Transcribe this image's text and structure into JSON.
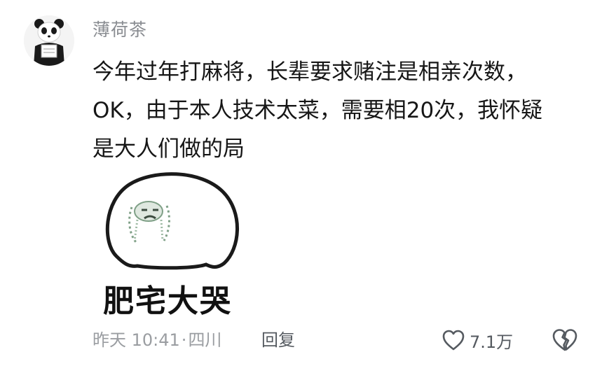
{
  "comment": {
    "username": "薄荷茶",
    "text_lines": [
      "今年过年打麻将，长辈要求赌注是相亲次数，",
      "OK，由于本人技术太菜，需要相20次，我怀疑",
      "是大人们做的局"
    ],
    "sticker_caption": "肥宅大哭",
    "time": "昨天 10:41",
    "separator": "·",
    "location": "四川",
    "reply_label": "回复",
    "like_count": "7.1万"
  },
  "icons": {
    "avatar": "panda-avatar",
    "sticker": "crying-blob-sticker",
    "like": "heart-outline-icon",
    "dislike": "broken-heart-icon"
  },
  "colors": {
    "username": "#8a8d92",
    "text": "#161616",
    "meta": "#9a9da1",
    "action": "#555a60"
  }
}
